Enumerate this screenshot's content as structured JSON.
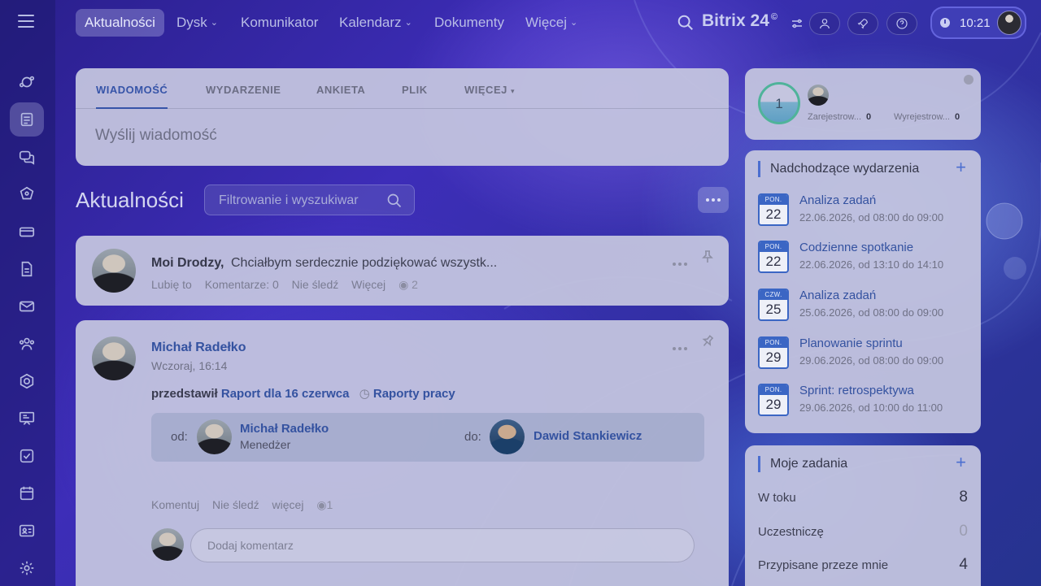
{
  "topnav": {
    "items": [
      {
        "label": "Aktualności",
        "active": true
      },
      {
        "label": "Dysk",
        "dropdown": true
      },
      {
        "label": "Komunikator"
      },
      {
        "label": "Kalendarz",
        "dropdown": true
      },
      {
        "label": "Dokumenty"
      },
      {
        "label": "Więcej",
        "dropdown": true
      }
    ],
    "brand": "Bitrix 24",
    "brand_mark": "©",
    "clock": "10:21"
  },
  "sidebar": {
    "icons": [
      "menu-icon",
      "activity-icon",
      "feed-icon",
      "chat-icon",
      "crm-icon",
      "card-icon",
      "document-icon",
      "mail-icon",
      "group-icon",
      "settings-hex-icon",
      "presentation-icon",
      "tasks-icon",
      "calendar-icon",
      "contact-card-icon",
      "gear-icon"
    ]
  },
  "composer": {
    "tabs": [
      "WIADOMOŚĆ",
      "WYDARZENIE",
      "ANKIETA",
      "PLIK",
      "WIĘCEJ"
    ],
    "placeholder": "Wyślij wiadomość"
  },
  "feed": {
    "title": "Aktualności",
    "filter_placeholder": "Filtrowanie i wyszukiwar"
  },
  "post1": {
    "author": "Moi Drodzy,",
    "excerpt": "Chciałbym serdecznie podziękować wszystk...",
    "actions": [
      "Lubię to",
      "Komentarze:  0",
      "Nie śledź",
      "Więcej"
    ],
    "views": "2"
  },
  "post2": {
    "author": "Michał Radełko",
    "time": "Wczoraj, 16:14",
    "verb": "przedstawił",
    "report_link": "Raport dla 16 czerwca",
    "report_category": "Raporty pracy",
    "from_label": "od:",
    "from_name": "Michał Radełko",
    "from_role": "Menedżer",
    "to_label": "do:",
    "to_name": "Dawid Stankiewicz",
    "actions": [
      "Komentuj",
      "Nie śledź",
      "więcej"
    ],
    "views": "1",
    "comment_placeholder": "Dodaj komentarz"
  },
  "stats": {
    "count": "1",
    "registered_label": "Zarejestrow...",
    "registered_value": "0",
    "unregistered_label": "Wyrejestrow...",
    "unregistered_value": "0"
  },
  "events": {
    "title": "Nadchodzące wydarzenia",
    "items": [
      {
        "dow": "PON.",
        "day": "22",
        "title": "Analiza zadań",
        "when": "22.06.2026, od 08:00 do 09:00"
      },
      {
        "dow": "PON.",
        "day": "22",
        "title": "Codzienne spotkanie",
        "when": "22.06.2026, od 13:10 do 14:10"
      },
      {
        "dow": "CZW.",
        "day": "25",
        "title": "Analiza zadań",
        "when": "25.06.2026, od 08:00 do 09:00"
      },
      {
        "dow": "PON.",
        "day": "29",
        "title": "Planowanie sprintu",
        "when": "29.06.2026, od 08:00 do 09:00"
      },
      {
        "dow": "PON.",
        "day": "29",
        "title": "Sprint: retrospektywa",
        "when": "29.06.2026, od 10:00 do 11:00"
      }
    ]
  },
  "tasks": {
    "title": "Moje zadania",
    "rows": [
      {
        "label": "W toku",
        "value": "8"
      },
      {
        "label": "Uczestniczę",
        "value": "0"
      },
      {
        "label": "Przypisane przeze mnie",
        "value": "4"
      }
    ]
  },
  "colors": {
    "accent": "#3452a0",
    "ring": "#4fb39a"
  }
}
